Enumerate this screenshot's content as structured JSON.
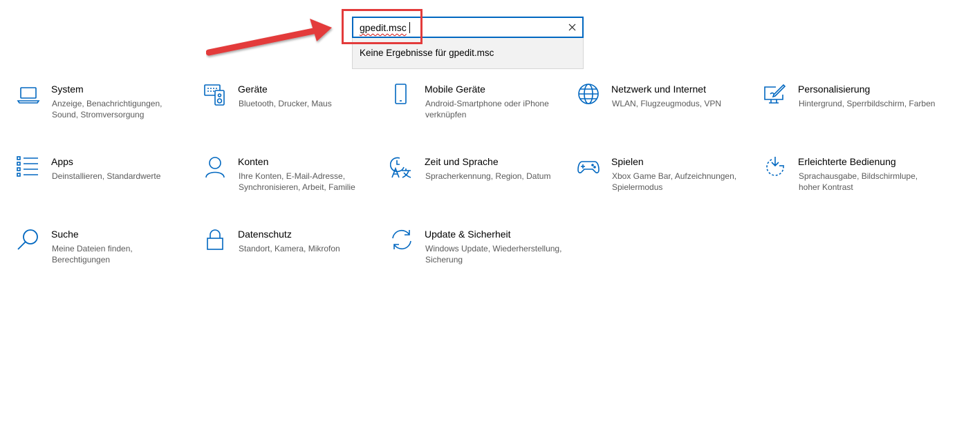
{
  "search": {
    "value": "gpedit.msc",
    "no_results": "Keine Ergebnisse für gpedit.msc"
  },
  "tiles": [
    {
      "title": "System",
      "desc": "Anzeige, Benachrichtigungen, Sound, Stromversorgung",
      "icon": "laptop-icon"
    },
    {
      "title": "Geräte",
      "desc": "Bluetooth, Drucker, Maus",
      "icon": "devices-icon"
    },
    {
      "title": "Mobile Geräte",
      "desc": "Android-Smartphone oder iPhone verknüpfen",
      "icon": "phone-icon"
    },
    {
      "title": "Netzwerk und Internet",
      "desc": "WLAN, Flugzeugmodus, VPN",
      "icon": "globe-icon"
    },
    {
      "title": "Personalisierung",
      "desc": "Hintergrund, Sperrbildschirm, Farben",
      "icon": "paint-monitor-icon"
    },
    {
      "title": "Apps",
      "desc": "Deinstallieren, Standardwerte",
      "icon": "apps-list-icon"
    },
    {
      "title": "Konten",
      "desc": "Ihre Konten, E-Mail-Adresse, Synchronisieren, Arbeit, Familie",
      "icon": "person-icon"
    },
    {
      "title": "Zeit und Sprache",
      "desc": "Spracherkennung, Region, Datum",
      "icon": "time-language-icon"
    },
    {
      "title": "Spielen",
      "desc": "Xbox Game Bar, Aufzeichnungen, Spielermodus",
      "icon": "gamepad-icon"
    },
    {
      "title": "Erleichterte Bedienung",
      "desc": "Sprachausgabe, Bildschirmlupe, hoher Kontrast",
      "icon": "ease-of-access-icon"
    },
    {
      "title": "Suche",
      "desc": "Meine Dateien finden, Berechtigungen",
      "icon": "search-icon"
    },
    {
      "title": "Datenschutz",
      "desc": "Standort, Kamera, Mikrofon",
      "icon": "lock-icon"
    },
    {
      "title": "Update & Sicherheit",
      "desc": "Windows Update, Wiederherstellung, Sicherung",
      "icon": "sync-icon"
    }
  ],
  "colors": {
    "accent": "#0067c0",
    "annotation": "#e33b3b"
  }
}
